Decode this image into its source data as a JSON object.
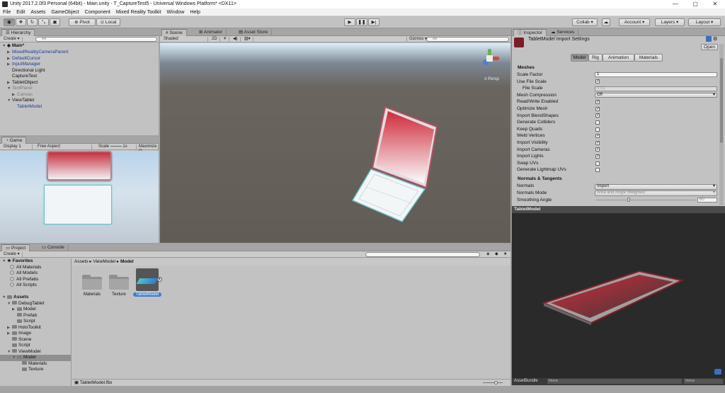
{
  "window": {
    "title": "Unity 2017.2.0f3 Personal (64bit) - Main.unity - T_CaptureTest5 - Universal Windows Platform* <DX11>",
    "minimize": "—",
    "maximize": "▢",
    "close": "✕"
  },
  "menu": [
    "File",
    "Edit",
    "Assets",
    "GameObject",
    "Component",
    "Mixed Reality Toolkit",
    "Window",
    "Help"
  ],
  "toolbar": {
    "pivot": "Pivot",
    "local": "Local",
    "collab": "Collab ▾",
    "account": "Account ▾",
    "layers": "Layers ▾",
    "layout": "Layout ▾"
  },
  "hierarchy": {
    "tab": "Hierarchy",
    "create": "Create ▾",
    "search_placeholder": "All",
    "scene": "Main*",
    "items": [
      {
        "label": "MixedRealityCameraParent",
        "style": "blue",
        "arrow": "▶",
        "indent": 1
      },
      {
        "label": "DefaultCursor",
        "style": "blue",
        "arrow": "▶",
        "indent": 1
      },
      {
        "label": "InputManager",
        "style": "blue",
        "arrow": "▶",
        "indent": 1
      },
      {
        "label": "Directional Light",
        "style": "",
        "arrow": "",
        "indent": 1
      },
      {
        "label": "CaptureTest",
        "style": "",
        "arrow": "",
        "indent": 1
      },
      {
        "label": "TabletObject",
        "style": "",
        "arrow": "▶",
        "indent": 1
      },
      {
        "label": "TextPanel",
        "style": "grey",
        "arrow": "▼",
        "indent": 1
      },
      {
        "label": "Canvas",
        "style": "grey",
        "arrow": "▶",
        "indent": 2
      },
      {
        "label": "ViewTablet",
        "style": "",
        "arrow": "▼",
        "indent": 1
      },
      {
        "label": "TabletModel",
        "style": "blue",
        "arrow": "",
        "indent": 2
      }
    ]
  },
  "game": {
    "tab": "Game",
    "display": "Display 1",
    "aspect": "Free Aspect",
    "scale_label": "Scale",
    "scale_value": "1x",
    "maximize": "Maximize O"
  },
  "scene": {
    "tabs": [
      "Scene",
      "Animator",
      "Asset Store"
    ],
    "shading": "Shaded",
    "mode_2d": "2D",
    "gizmos": "Gizmos ▾",
    "search_placeholder": "All",
    "persp": "Persp"
  },
  "inspector": {
    "tabs": [
      "Inspector",
      "Services"
    ],
    "title": "TabletModel Import Settings",
    "open": "Open",
    "subtabs": [
      "Model",
      "Rig",
      "Animation",
      "Materials"
    ],
    "section_meshes": "Meshes",
    "rows": [
      {
        "label": "Scale Factor",
        "type": "text",
        "value": "1"
      },
      {
        "label": "Use File Scale",
        "type": "check",
        "checked": true
      },
      {
        "label": "File Scale",
        "type": "textgrey",
        "value": "0.01",
        "indent": true
      },
      {
        "label": "Mesh Compression",
        "type": "dropdown",
        "value": "Off"
      },
      {
        "label": "Read/Write Enabled",
        "type": "check",
        "checked": true
      },
      {
        "label": "Optimize Mesh",
        "type": "check",
        "checked": true
      },
      {
        "label": "Import BlendShapes",
        "type": "check",
        "checked": true
      },
      {
        "label": "Generate Colliders",
        "type": "check",
        "checked": false
      },
      {
        "label": "Keep Quads",
        "type": "check",
        "checked": false
      },
      {
        "label": "Weld Vertices",
        "type": "check",
        "checked": true
      },
      {
        "label": "Import Visibility",
        "type": "check",
        "checked": true
      },
      {
        "label": "Import Cameras",
        "type": "check",
        "checked": true
      },
      {
        "label": "Import Lights",
        "type": "check",
        "checked": true
      },
      {
        "label": "Swap UVs",
        "type": "check",
        "checked": false
      },
      {
        "label": "Generate Lightmap UVs",
        "type": "check",
        "checked": false
      }
    ],
    "section_normals": "Normals & Tangents",
    "normals": {
      "label": "Normals",
      "value": "Import"
    },
    "normals_mode": {
      "label": "Normals Mode",
      "value": "Area and Angle Weighted"
    },
    "smoothing": {
      "label": "Smoothing Angle",
      "value": "60"
    },
    "preview_title": "TabletModel",
    "assetbundle": "AssetBundle",
    "ab_name": "None",
    "ab_variant": "None"
  },
  "project": {
    "tabs": [
      "Project",
      "Console"
    ],
    "create": "Create ▾",
    "favorites_label": "Favorites",
    "favorites": [
      "All Materials",
      "All Models",
      "All Prefabs",
      "All Scripts"
    ],
    "assets_label": "Assets",
    "tree": [
      {
        "label": "DebugTablet",
        "indent": 1,
        "arrow": "▼"
      },
      {
        "label": "Model",
        "indent": 2,
        "arrow": "▶"
      },
      {
        "label": "Prefab",
        "indent": 2,
        "arrow": ""
      },
      {
        "label": "Script",
        "indent": 2,
        "arrow": ""
      },
      {
        "label": "HoloToolkit",
        "indent": 1,
        "arrow": "▶"
      },
      {
        "label": "Image",
        "indent": 1,
        "arrow": "▶"
      },
      {
        "label": "Scene",
        "indent": 1,
        "arrow": ""
      },
      {
        "label": "Script",
        "indent": 1,
        "arrow": ""
      },
      {
        "label": "ViewModel",
        "indent": 1,
        "arrow": "▼"
      },
      {
        "label": "Model",
        "indent": 2,
        "arrow": "▼",
        "selected": true
      },
      {
        "label": "Materials",
        "indent": 3,
        "arrow": ""
      },
      {
        "label": "Texture",
        "indent": 3,
        "arrow": ""
      }
    ],
    "breadcrumb": [
      "Assets",
      "ViewModel",
      "Model"
    ],
    "items": [
      {
        "label": "Materials",
        "kind": "folder"
      },
      {
        "label": "Texture",
        "kind": "folder"
      },
      {
        "label": "TabletModel",
        "kind": "model",
        "selected": true
      }
    ],
    "footer_file": "TabletModel.fbx"
  }
}
